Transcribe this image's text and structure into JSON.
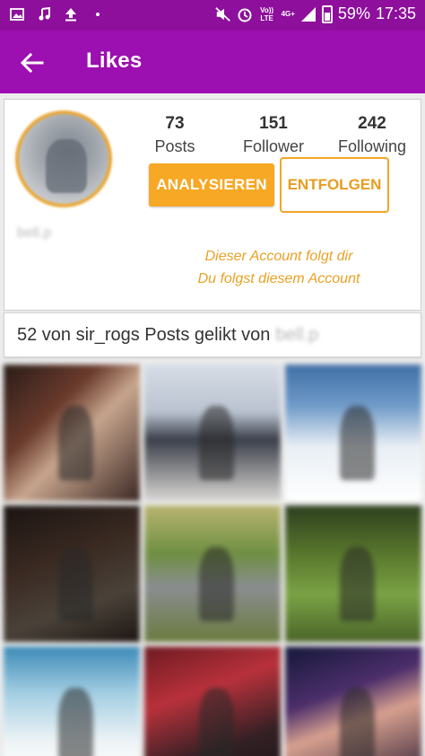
{
  "status_bar": {
    "left_icons": [
      "image-icon",
      "music-note-icon",
      "upload-icon",
      "dot-icon"
    ],
    "volte_label": "Vo)) LTE",
    "network_label": "4G+",
    "battery": "59%",
    "time": "17:35"
  },
  "app_bar": {
    "title": "Likes"
  },
  "profile": {
    "username": "bell.p",
    "stats": [
      {
        "value": "73",
        "label": "Posts"
      },
      {
        "value": "151",
        "label": "Follower"
      },
      {
        "value": "242",
        "label": "Following"
      }
    ],
    "analyse_label": "ANALYSIEREN",
    "unfollow_label": "ENTFOLGEN",
    "follow_status_1": "Dieser Account folgt dir",
    "follow_status_2": "Du folgst diesem Account"
  },
  "likes_summary": {
    "text": "52 von sir_rogs Posts gelikt von",
    "username": "bell.p"
  },
  "colors": {
    "status_bar": "#8e0f9c",
    "app_bar": "#9c0fb0",
    "accent": "#f7a824"
  },
  "posts_grid": {
    "tile_count": 9
  }
}
